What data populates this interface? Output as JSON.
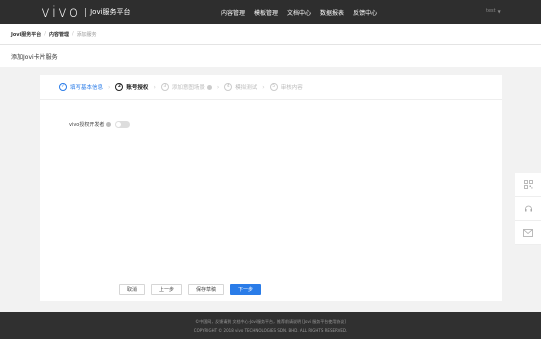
{
  "header": {
    "logo_word": "vivo",
    "logo_sub": "Jovi服务平台",
    "nav": [
      "内容管理",
      "模板管理",
      "文档中心",
      "数据报表",
      "反馈中心"
    ],
    "user": "test"
  },
  "breadcrumb": [
    "Jovi服务平台",
    "内容管理",
    "添加服务"
  ],
  "page_title": "添加Jovi卡片服务",
  "steps": [
    {
      "num": "✓",
      "label": "填写基本信息",
      "state": "done"
    },
    {
      "num": "2",
      "label": "账号授权",
      "state": "active"
    },
    {
      "num": "3",
      "label": "添加意图场景",
      "state": "pending"
    },
    {
      "num": "4",
      "label": "模拟测试",
      "state": "pending"
    },
    {
      "num": "5",
      "label": "审核内容",
      "state": "pending"
    }
  ],
  "form": {
    "field_label": "vivo授权开发者",
    "toggle_on": false
  },
  "buttons": {
    "cancel": "取消",
    "prev": "上一步",
    "save_draft": "保存草稿",
    "next": "下一步"
  },
  "footer": {
    "line1": "©中国网，反馈请到 文档中心-Jovi服务平台，推荐前请说明 [Jovi 服务平台使用协议]",
    "line2": "COPYRIGHT © 2018 vivo TECHNOLOGIES SDN. BHD. ALL RIGHTS RESERVED."
  },
  "colors": {
    "accent": "#2a7ce8",
    "topbar": "#2e2e2e",
    "footer": "#303030"
  }
}
